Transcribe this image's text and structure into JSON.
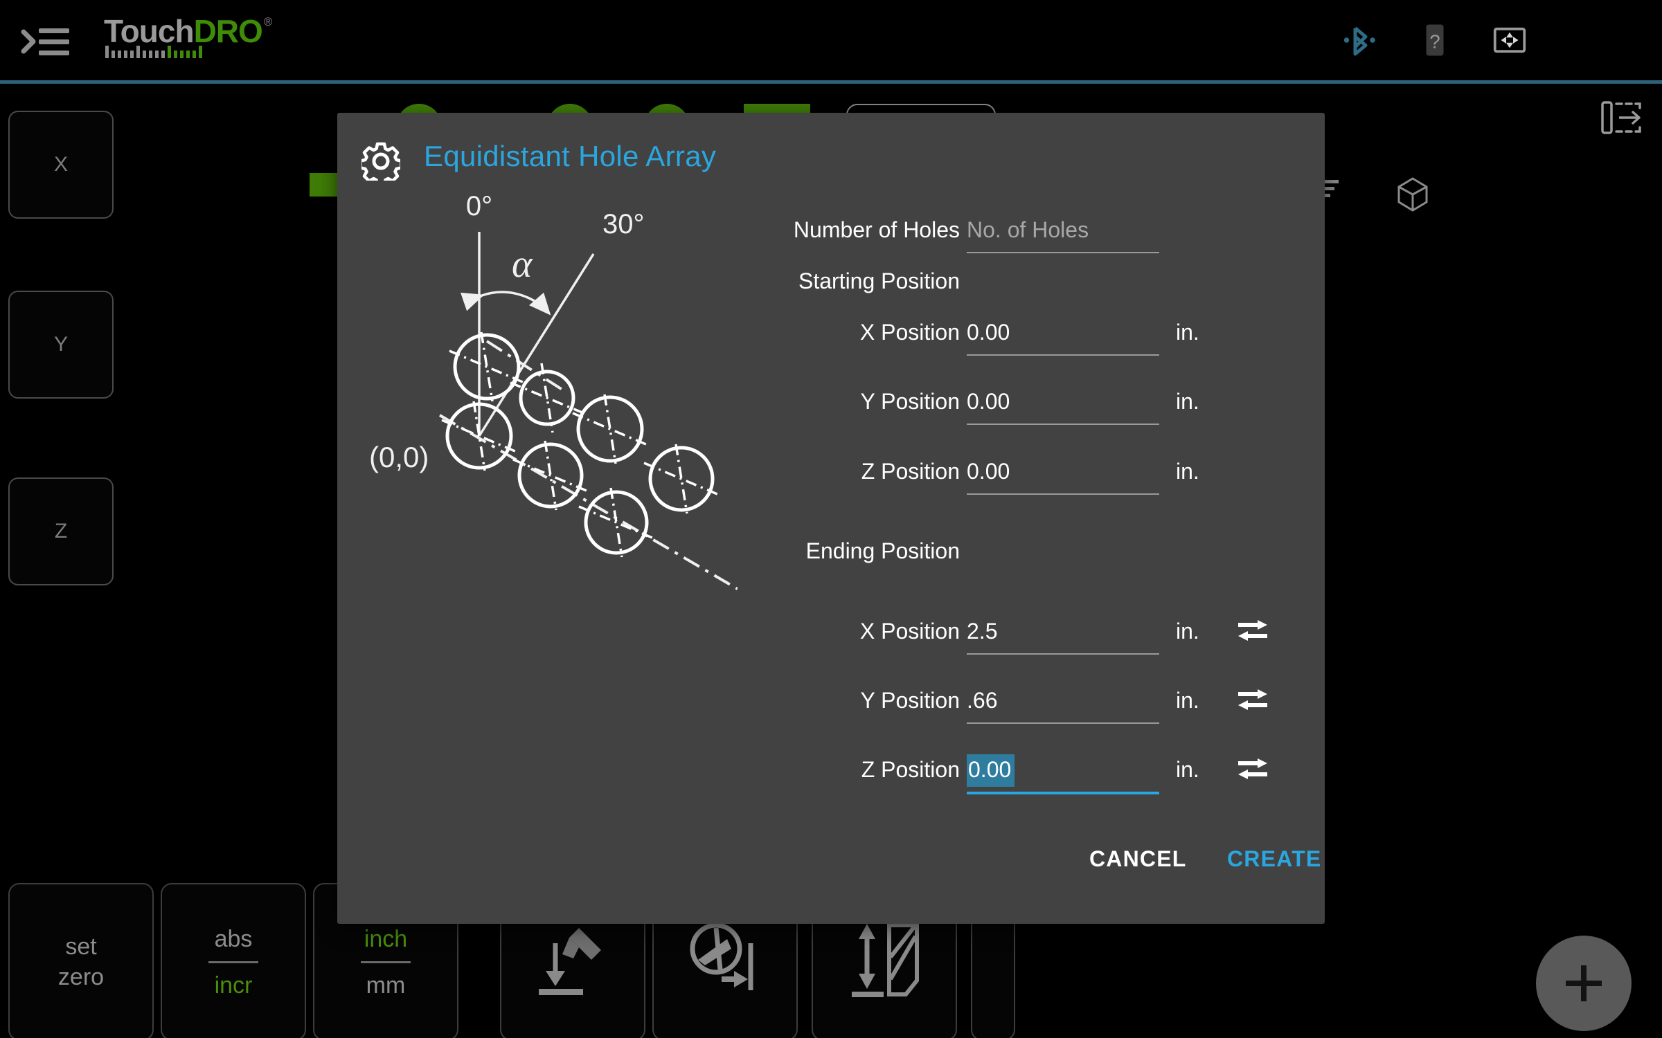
{
  "app": {
    "brand_touch": "Touch",
    "brand_dro": "DRO",
    "brand_reg": "®",
    "accent_blue": "#2aa7e0",
    "accent_green": "#3f8c09",
    "dialog_bg": "#424242",
    "divider_teal": "#2d617a"
  },
  "topbar": {
    "menu_icon": "hamburger-menu-icon",
    "bluetooth_icon": "bluetooth-icon",
    "help_icon": "device-help-icon",
    "fullscreen_icon": "fullscreen-icon"
  },
  "axes": [
    {
      "label": "X",
      "name": "axis-button-x"
    },
    {
      "label": "Y",
      "name": "axis-button-y"
    },
    {
      "label": "Z",
      "name": "axis-button-z"
    }
  ],
  "bottom_bar": {
    "set_zero_line1": "set",
    "set_zero_line2": "zero",
    "abs_label": "abs",
    "incr_label": "incr",
    "inch_label": "inch",
    "mm_label": "mm",
    "tool_icon_1": "tool-probe-down-icon",
    "tool_icon_2": "tool-edge-find-icon",
    "tool_icon_3": "tool-height-icon",
    "fab_icon": "add-plus-icon"
  },
  "right_icons": {
    "panel_expand_icon": "panel-expand-right-icon",
    "list_icon": "list-lines-icon",
    "cube_icon": "cube-3d-icon"
  },
  "dialog": {
    "gear_icon": "gear-settings-icon",
    "title": "Equidistant Hole Array",
    "diagram": {
      "label_zero_deg": "0°",
      "label_thirty_deg": "30°",
      "label_alpha": "α",
      "label_origin": "(0,0)"
    },
    "number_of_holes": {
      "label": "Number of Holes",
      "value": "",
      "placeholder": "No. of Holes"
    },
    "starting_position": {
      "section_label": "Starting Position",
      "fields": [
        {
          "label": "X Position",
          "value": "0.00",
          "unit": "in."
        },
        {
          "label": "Y Position",
          "value": "0.00",
          "unit": "in."
        },
        {
          "label": "Z Position",
          "value": "0.00",
          "unit": "in."
        }
      ]
    },
    "ending_position": {
      "section_label": "Ending Position",
      "fields": [
        {
          "label": "X Position",
          "value": "2.5",
          "unit": "in.",
          "swap_icon": "swap-arrows-icon"
        },
        {
          "label": "Y Position",
          "value": ".66",
          "unit": "in.",
          "swap_icon": "swap-arrows-icon"
        },
        {
          "label": "Z Position",
          "value": "0.00",
          "unit": "in.",
          "swap_icon": "swap-arrows-icon",
          "focused": true,
          "selected": true
        }
      ]
    },
    "actions": {
      "cancel_label": "CANCEL",
      "create_label": "CREATE"
    }
  }
}
